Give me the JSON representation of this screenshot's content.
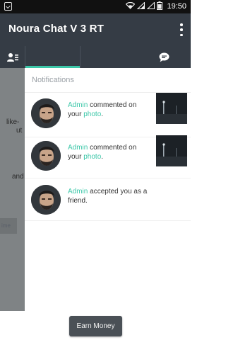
{
  "statusbar": {
    "time": "19:50",
    "battery_icon": "battery-icon",
    "signal_icon": "signal-icon",
    "wifi_icon": "wifi-icon"
  },
  "appbar": {
    "title": "Noura Chat V 3 RT"
  },
  "tabs": {
    "left_icon": "contacts-icon",
    "right_icon": "chat-bubble-icon"
  },
  "background_fragments": [
    "like-",
    "ut",
    "and",
    "ime"
  ],
  "drawer": {
    "header": "Notifications",
    "items": [
      {
        "name": "Admin",
        "pre": " commented on your ",
        "link": "photo",
        "post": ".",
        "has_thumb": true
      },
      {
        "name": "Admin",
        "pre": " commented on your ",
        "link": "photo",
        "post": ".",
        "has_thumb": true
      },
      {
        "name": "Admin",
        "pre": " accepted you as a friend.",
        "link": "",
        "post": "",
        "has_thumb": false
      }
    ]
  },
  "earn_button": "Earn Money",
  "colors": {
    "accent": "#3bc7a8",
    "appbar": "#353c45",
    "statusbar": "#111111"
  }
}
